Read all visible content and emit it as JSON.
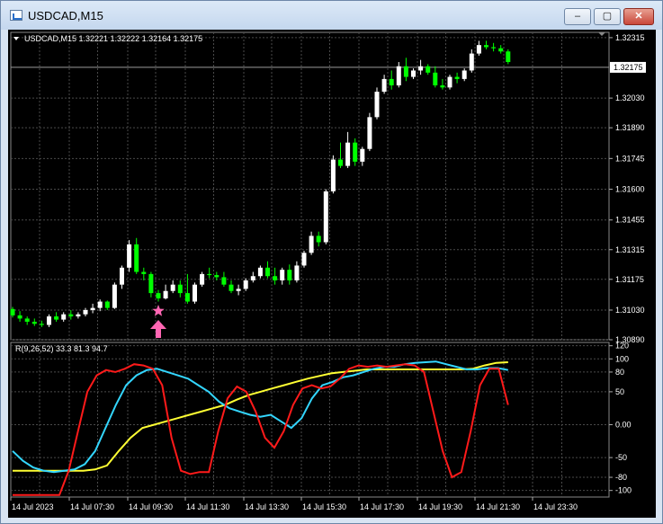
{
  "window": {
    "title": "USDCAD,M15",
    "min_symbol": "–",
    "max_symbol": "▢",
    "close_symbol": "✕"
  },
  "main_panel": {
    "header": "USDCAD,M15  1.32221 1.32222 1.32164 1.32175",
    "current_price": "1.32175",
    "price_labels": [
      "1.32315",
      "1.32030",
      "1.31890",
      "1.31745",
      "1.31600",
      "1.31455",
      "1.31315",
      "1.31175",
      "1.31030",
      "1.30890"
    ]
  },
  "indicator_panel": {
    "header": "R(9,26,52) 33.3 81.3 94.7",
    "scale_labels": [
      "120",
      "100",
      "80",
      "50",
      "0.00",
      "-50",
      "-80",
      "-100"
    ]
  },
  "time_labels": [
    "14 Jul 2023",
    "14 Jul 07:30",
    "14 Jul 09:30",
    "14 Jul 11:30",
    "14 Jul 13:30",
    "14 Jul 15:30",
    "14 Jul 17:30",
    "14 Jul 19:30",
    "14 Jul 21:30",
    "14 Jul 23:30"
  ],
  "colors": {
    "bull": "#ffffff",
    "bear": "#00ff00",
    "grid": "#4a4a4a",
    "red_line": "#ff1a1a",
    "cyan_line": "#33d6ff",
    "yellow_line": "#ffff33",
    "marker": "#ff66b3"
  },
  "chart_data": {
    "type": "candlestick",
    "symbol": "USDCAD",
    "timeframe": "M15",
    "price_range": [
      1.3089,
      1.3234
    ],
    "candles": [
      {
        "o": 1.31035,
        "h": 1.31045,
        "l": 1.30995,
        "c": 1.31005
      },
      {
        "o": 1.31005,
        "h": 1.31025,
        "l": 1.30975,
        "c": 1.3099
      },
      {
        "o": 1.3099,
        "h": 1.31,
        "l": 1.3096,
        "c": 1.30975
      },
      {
        "o": 1.30975,
        "h": 1.3099,
        "l": 1.30955,
        "c": 1.30965
      },
      {
        "o": 1.30965,
        "h": 1.3098,
        "l": 1.3095,
        "c": 1.3096
      },
      {
        "o": 1.3096,
        "h": 1.3101,
        "l": 1.3095,
        "c": 1.31
      },
      {
        "o": 1.31,
        "h": 1.3102,
        "l": 1.30975,
        "c": 1.30985
      },
      {
        "o": 1.30985,
        "h": 1.3102,
        "l": 1.30975,
        "c": 1.3101
      },
      {
        "o": 1.3101,
        "h": 1.3103,
        "l": 1.30985,
        "c": 1.31
      },
      {
        "o": 1.31,
        "h": 1.3102,
        "l": 1.3099,
        "c": 1.3101
      },
      {
        "o": 1.3101,
        "h": 1.3104,
        "l": 1.31,
        "c": 1.3103
      },
      {
        "o": 1.3103,
        "h": 1.3106,
        "l": 1.31015,
        "c": 1.3104
      },
      {
        "o": 1.3104,
        "h": 1.3108,
        "l": 1.31025,
        "c": 1.3107
      },
      {
        "o": 1.3107,
        "h": 1.31075,
        "l": 1.3103,
        "c": 1.3104
      },
      {
        "o": 1.3104,
        "h": 1.3116,
        "l": 1.31035,
        "c": 1.3115
      },
      {
        "o": 1.3115,
        "h": 1.3124,
        "l": 1.3113,
        "c": 1.3123
      },
      {
        "o": 1.3123,
        "h": 1.3136,
        "l": 1.3121,
        "c": 1.3134
      },
      {
        "o": 1.3134,
        "h": 1.3137,
        "l": 1.312,
        "c": 1.3121
      },
      {
        "o": 1.3121,
        "h": 1.3123,
        "l": 1.3117,
        "c": 1.312
      },
      {
        "o": 1.312,
        "h": 1.3121,
        "l": 1.3109,
        "c": 1.3111
      },
      {
        "o": 1.3111,
        "h": 1.31125,
        "l": 1.3107,
        "c": 1.31085
      },
      {
        "o": 1.31085,
        "h": 1.3115,
        "l": 1.3108,
        "c": 1.3112
      },
      {
        "o": 1.3112,
        "h": 1.3117,
        "l": 1.3111,
        "c": 1.3115
      },
      {
        "o": 1.3115,
        "h": 1.3117,
        "l": 1.3109,
        "c": 1.3111
      },
      {
        "o": 1.3111,
        "h": 1.312,
        "l": 1.3106,
        "c": 1.3107
      },
      {
        "o": 1.3107,
        "h": 1.3116,
        "l": 1.3106,
        "c": 1.3115
      },
      {
        "o": 1.3115,
        "h": 1.3121,
        "l": 1.3114,
        "c": 1.312
      },
      {
        "o": 1.312,
        "h": 1.3123,
        "l": 1.3118,
        "c": 1.31195
      },
      {
        "o": 1.31195,
        "h": 1.3121,
        "l": 1.3117,
        "c": 1.31185
      },
      {
        "o": 1.31185,
        "h": 1.3121,
        "l": 1.3114,
        "c": 1.3115
      },
      {
        "o": 1.3115,
        "h": 1.3117,
        "l": 1.3111,
        "c": 1.3112
      },
      {
        "o": 1.3112,
        "h": 1.3115,
        "l": 1.311,
        "c": 1.3113
      },
      {
        "o": 1.3113,
        "h": 1.3118,
        "l": 1.3112,
        "c": 1.3117
      },
      {
        "o": 1.3117,
        "h": 1.3121,
        "l": 1.3116,
        "c": 1.3119
      },
      {
        "o": 1.3119,
        "h": 1.3124,
        "l": 1.3118,
        "c": 1.3123
      },
      {
        "o": 1.3123,
        "h": 1.3126,
        "l": 1.3118,
        "c": 1.3119
      },
      {
        "o": 1.3119,
        "h": 1.3123,
        "l": 1.3115,
        "c": 1.3117
      },
      {
        "o": 1.3117,
        "h": 1.3123,
        "l": 1.3115,
        "c": 1.3122
      },
      {
        "o": 1.3122,
        "h": 1.31245,
        "l": 1.3115,
        "c": 1.3117
      },
      {
        "o": 1.3117,
        "h": 1.3126,
        "l": 1.3116,
        "c": 1.3124
      },
      {
        "o": 1.3124,
        "h": 1.3131,
        "l": 1.3123,
        "c": 1.313
      },
      {
        "o": 1.313,
        "h": 1.314,
        "l": 1.3129,
        "c": 1.3138
      },
      {
        "o": 1.3138,
        "h": 1.314,
        "l": 1.3133,
        "c": 1.3135
      },
      {
        "o": 1.3135,
        "h": 1.316,
        "l": 1.3134,
        "c": 1.3159
      },
      {
        "o": 1.3159,
        "h": 1.3176,
        "l": 1.3158,
        "c": 1.3174
      },
      {
        "o": 1.3174,
        "h": 1.3182,
        "l": 1.317,
        "c": 1.3171
      },
      {
        "o": 1.3171,
        "h": 1.3187,
        "l": 1.317,
        "c": 1.3182
      },
      {
        "o": 1.3182,
        "h": 1.3184,
        "l": 1.3171,
        "c": 1.3173
      },
      {
        "o": 1.3173,
        "h": 1.318,
        "l": 1.3171,
        "c": 1.3179
      },
      {
        "o": 1.3179,
        "h": 1.3196,
        "l": 1.3178,
        "c": 1.3194
      },
      {
        "o": 1.3194,
        "h": 1.3208,
        "l": 1.3193,
        "c": 1.3206
      },
      {
        "o": 1.3206,
        "h": 1.3214,
        "l": 1.3205,
        "c": 1.3212
      },
      {
        "o": 1.3212,
        "h": 1.3216,
        "l": 1.3207,
        "c": 1.3209
      },
      {
        "o": 1.3209,
        "h": 1.322,
        "l": 1.3208,
        "c": 1.3218
      },
      {
        "o": 1.3218,
        "h": 1.3222,
        "l": 1.3211,
        "c": 1.3213
      },
      {
        "o": 1.3213,
        "h": 1.3217,
        "l": 1.3212,
        "c": 1.3216
      },
      {
        "o": 1.3216,
        "h": 1.3221,
        "l": 1.3214,
        "c": 1.3218
      },
      {
        "o": 1.3218,
        "h": 1.3219,
        "l": 1.3214,
        "c": 1.3215
      },
      {
        "o": 1.3215,
        "h": 1.3218,
        "l": 1.3208,
        "c": 1.3209
      },
      {
        "o": 1.3209,
        "h": 1.3212,
        "l": 1.3207,
        "c": 1.3208
      },
      {
        "o": 1.3208,
        "h": 1.3214,
        "l": 1.3207,
        "c": 1.3213
      },
      {
        "o": 1.3213,
        "h": 1.3215,
        "l": 1.321,
        "c": 1.3212
      },
      {
        "o": 1.3212,
        "h": 1.3217,
        "l": 1.3211,
        "c": 1.3216
      },
      {
        "o": 1.3216,
        "h": 1.3226,
        "l": 1.3215,
        "c": 1.3224
      },
      {
        "o": 1.3224,
        "h": 1.323,
        "l": 1.3223,
        "c": 1.3228
      },
      {
        "o": 1.3228,
        "h": 1.323,
        "l": 1.3226,
        "c": 1.3227
      },
      {
        "o": 1.3227,
        "h": 1.3229,
        "l": 1.3225,
        "c": 1.32265
      },
      {
        "o": 1.32265,
        "h": 1.3228,
        "l": 1.3224,
        "c": 1.3225
      },
      {
        "o": 1.3225,
        "h": 1.3226,
        "l": 1.3219,
        "c": 1.322
      }
    ],
    "indicator": {
      "range": [
        -110,
        125
      ],
      "red": [
        -107,
        -107,
        -107,
        -107,
        -107,
        -107,
        -70,
        -10,
        50,
        75,
        83,
        80,
        85,
        92,
        90,
        85,
        60,
        -20,
        -70,
        -75,
        -72,
        -72,
        -10,
        40,
        58,
        50,
        20,
        -20,
        -35,
        -10,
        30,
        55,
        60,
        55,
        58,
        70,
        85,
        90,
        88,
        90,
        88,
        90,
        92,
        90,
        80,
        20,
        -40,
        -80,
        -72,
        -10,
        60,
        85,
        85,
        30
      ],
      "cyan": [
        -40,
        -55,
        -65,
        -70,
        -72,
        -70,
        -68,
        -60,
        -40,
        -5,
        30,
        60,
        75,
        83,
        85,
        80,
        75,
        70,
        60,
        50,
        35,
        25,
        20,
        15,
        12,
        15,
        5,
        -5,
        10,
        40,
        60,
        65,
        72,
        75,
        80,
        85,
        88,
        88,
        92,
        94,
        95,
        96,
        92,
        88,
        84,
        84,
        86,
        86,
        83
      ],
      "yellow": [
        -70,
        -70,
        -70,
        -70,
        -70,
        -70,
        -70,
        -68,
        -62,
        -40,
        -20,
        -5,
        0,
        5,
        10,
        15,
        20,
        25,
        30,
        38,
        45,
        50,
        55,
        60,
        65,
        70,
        74,
        78,
        80,
        82,
        84,
        84,
        84,
        84,
        84,
        84,
        84,
        84,
        84,
        85,
        90,
        94,
        95
      ],
      "current": {
        "red": 33.3,
        "cyan": 81.3,
        "yellow": 94.7
      }
    },
    "marker": {
      "candle_index": 20,
      "price": 1.31085,
      "shape": "star-and-up-arrow"
    }
  }
}
